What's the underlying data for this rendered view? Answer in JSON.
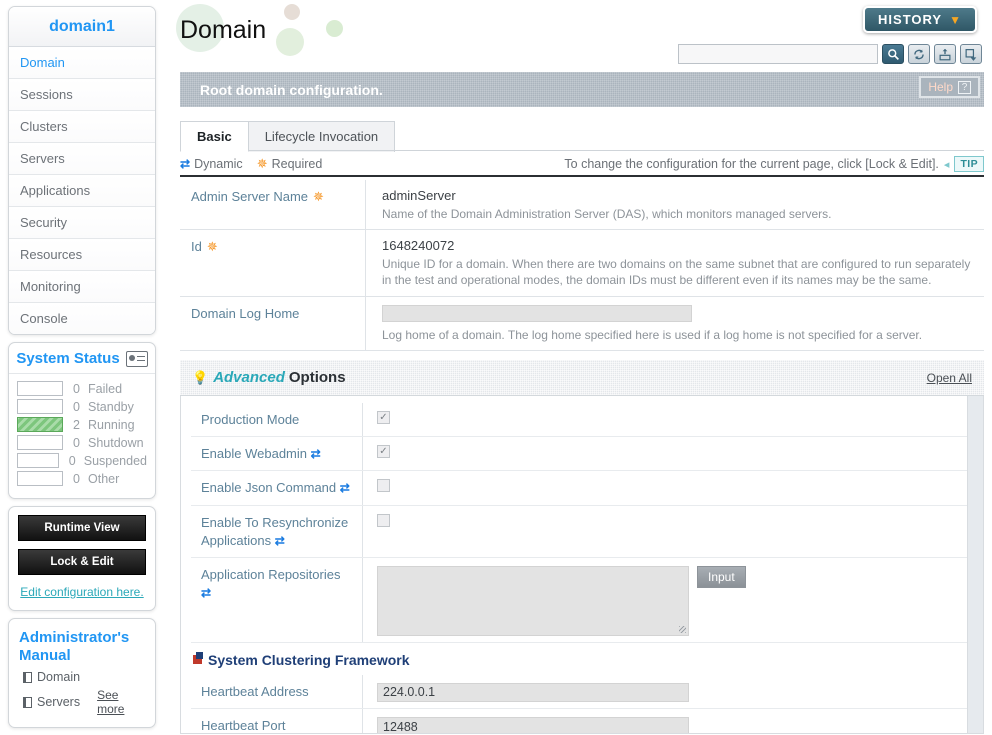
{
  "sidebar": {
    "domain_title": "domain1",
    "nav": [
      {
        "label": "Domain",
        "active": true
      },
      {
        "label": "Sessions",
        "active": false
      },
      {
        "label": "Clusters",
        "active": false
      },
      {
        "label": "Servers",
        "active": false
      },
      {
        "label": "Applications",
        "active": false
      },
      {
        "label": "Security",
        "active": false
      },
      {
        "label": "Resources",
        "active": false
      },
      {
        "label": "Monitoring",
        "active": false
      },
      {
        "label": "Console",
        "active": false
      }
    ],
    "status": {
      "title": "System Status",
      "rows": [
        {
          "count": "0",
          "label": "Failed",
          "filled": false
        },
        {
          "count": "0",
          "label": "Standby",
          "filled": false
        },
        {
          "count": "2",
          "label": "Running",
          "filled": true
        },
        {
          "count": "0",
          "label": "Shutdown",
          "filled": false
        },
        {
          "count": "0",
          "label": "Suspended",
          "filled": false
        },
        {
          "count": "0",
          "label": "Other",
          "filled": false
        }
      ]
    },
    "runtime_view_btn": "Runtime View",
    "lock_edit_btn": "Lock & Edit",
    "edit_config_link": "Edit configuration here.",
    "manual": {
      "title": "Administrator's Manual",
      "links": [
        "Domain",
        "Servers"
      ],
      "see_more": "See more"
    }
  },
  "topbar": {
    "history_label": "HISTORY",
    "history_chevron": "chevron-down-icon",
    "search_value": "",
    "search_placeholder": "",
    "icons": [
      "search-icon",
      "refresh-icon",
      "xml-upload-icon",
      "restore-icon"
    ]
  },
  "header": {
    "page_title": "Domain",
    "banner_text": "Root domain configuration.",
    "help_label": "Help"
  },
  "tabs": [
    {
      "label": "Basic",
      "active": true
    },
    {
      "label": "Lifecycle Invocation",
      "active": false
    }
  ],
  "legend": {
    "dynamic": "Dynamic",
    "required": "Required",
    "tip_text": "To change the configuration for the current page, click [Lock & Edit].",
    "tip_badge": "TIP"
  },
  "basic_fields": [
    {
      "label": "Admin Server Name",
      "required": true,
      "value": "adminServer",
      "description": "Name of the Domain Administration Server (DAS), which monitors managed servers.",
      "input": false
    },
    {
      "label": "Id",
      "required": true,
      "value": "1648240072",
      "description": "Unique ID for a domain. When there are two domains on the same subnet that are configured to run separately in the test and operational modes, the domain IDs must be different even if its names may be the same.",
      "input": false
    },
    {
      "label": "Domain Log Home",
      "required": false,
      "value": "",
      "description": "Log home of a domain. The log home specified here is used if a log home is not specified for a server.",
      "input": true
    }
  ],
  "advanced": {
    "title_italic": "Advanced",
    "title_rest": "Options",
    "open_all": "Open All",
    "checkboxes": [
      {
        "label": "Production Mode",
        "dynamic": false,
        "checked": true
      },
      {
        "label": "Enable Webadmin",
        "dynamic": true,
        "checked": true
      },
      {
        "label": "Enable Json Command",
        "dynamic": true,
        "checked": false
      },
      {
        "label": "Enable To Resynchronize Applications",
        "dynamic": true,
        "checked": false
      }
    ],
    "repositories": {
      "label": "Application Repositories",
      "dynamic": true,
      "value": "",
      "button": "Input"
    },
    "clustering": {
      "section_title": "System Clustering Framework",
      "fields": [
        {
          "label": "Heartbeat Address",
          "value": "224.0.0.1"
        },
        {
          "label": "Heartbeat Port",
          "value": "12488"
        }
      ]
    }
  }
}
